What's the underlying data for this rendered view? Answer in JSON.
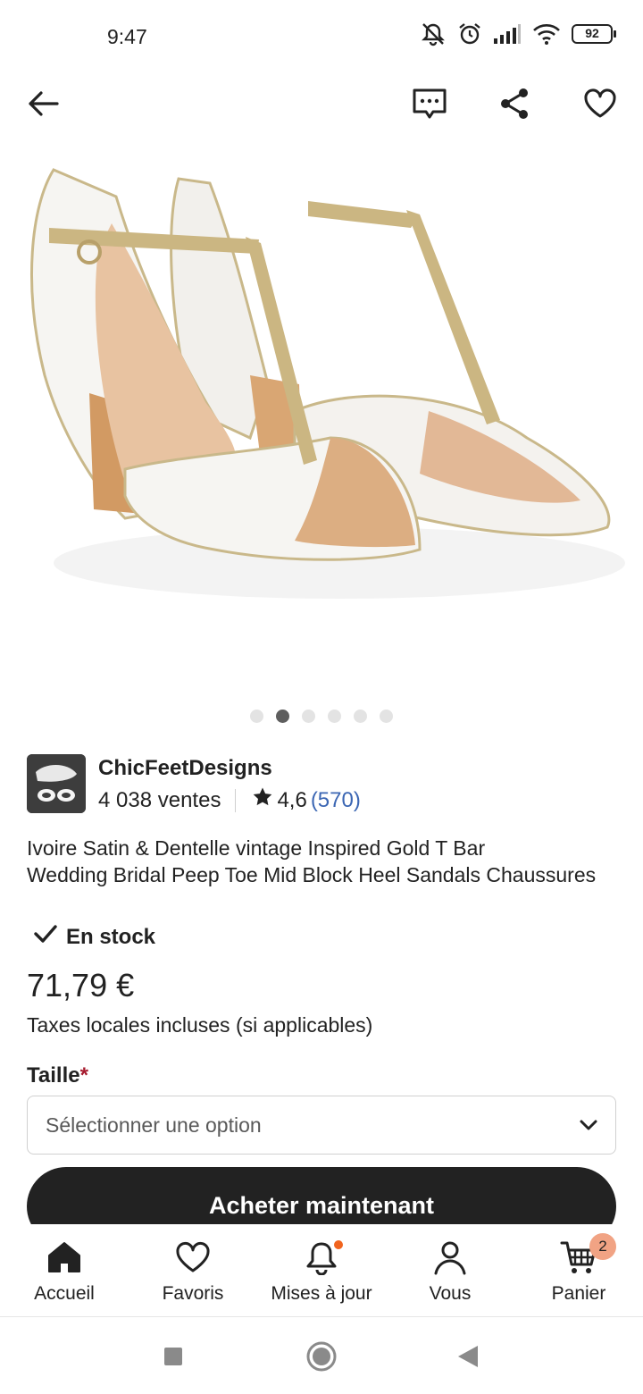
{
  "status_bar": {
    "time": "9:47",
    "battery": "92",
    "icons": [
      "mute-icon",
      "alarm-icon",
      "signal-icon",
      "wifi-icon",
      "battery-icon"
    ]
  },
  "top_bar": {
    "icons": [
      "back-arrow-icon",
      "message-icon",
      "share-icon",
      "heart-icon"
    ]
  },
  "carousel": {
    "total": 6,
    "active_index": 1
  },
  "shop": {
    "name": "ChicFeetDesigns",
    "sales": "4 038 ventes",
    "rating": "4,6",
    "review_count": "(570)"
  },
  "product": {
    "title_line1": "Ivoire Satin & Dentelle vintage Inspired Gold T Bar",
    "title_line2": "Wedding Bridal Peep Toe Mid Block Heel Sandals Chaussures",
    "stock": "En stock",
    "price": "71,79 €",
    "tax_note": "Taxes locales incluses (si applicables)"
  },
  "size": {
    "label": "Taille",
    "required_mark": "*",
    "placeholder": "Sélectionner une option"
  },
  "buy_button": "Acheter maintenant",
  "bottom_nav": {
    "items": [
      {
        "label": "Accueil",
        "icon": "home-icon"
      },
      {
        "label": "Favoris",
        "icon": "heart-icon"
      },
      {
        "label": "Mises à jour",
        "icon": "bell-icon"
      },
      {
        "label": "Vous",
        "icon": "user-icon"
      },
      {
        "label": "Panier",
        "icon": "cart-icon",
        "badge": "2"
      }
    ]
  },
  "colors": {
    "text": "#222222",
    "link": "#3b66b3",
    "accent": "#f1641e",
    "required": "#a61a2e",
    "button_bg": "#222222"
  }
}
